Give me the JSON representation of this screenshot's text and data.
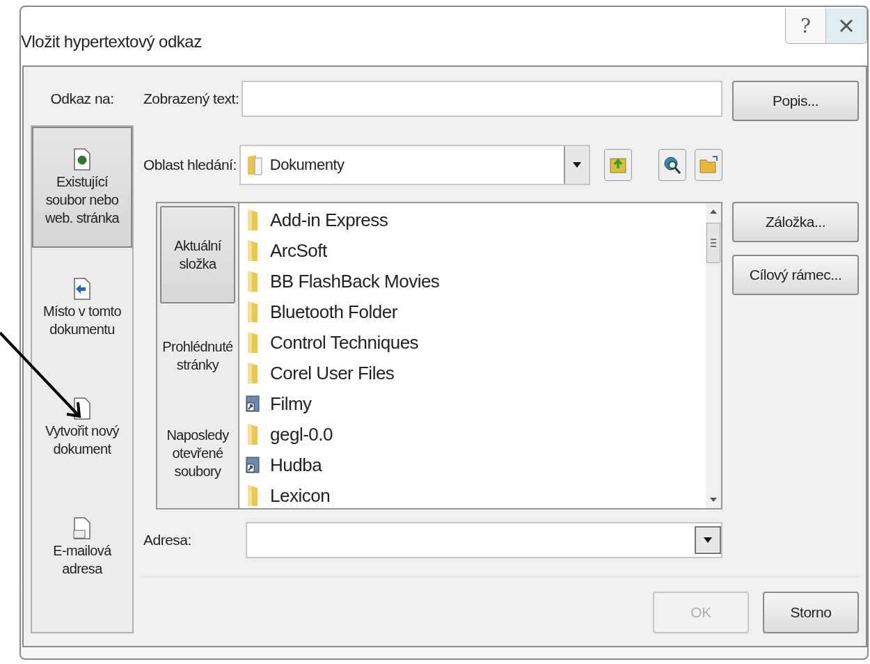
{
  "window": {
    "title": "Vložit hypertextový odkaz",
    "help": "?"
  },
  "link_to": {
    "label": "Odkaz na:",
    "items": [
      {
        "label": "Existující\nsoubor nebo\nweb. stránka",
        "kind": "file",
        "selected": true
      },
      {
        "label": "Místo v tomto\ndokumentu",
        "kind": "place",
        "selected": false
      },
      {
        "label": "Vytvořit nový\ndokument",
        "kind": "new",
        "selected": false
      },
      {
        "label": "E-mailová\nadresa",
        "kind": "mail",
        "selected": false
      }
    ]
  },
  "display_text": {
    "label": "Zobrazený text:"
  },
  "look_in": {
    "label": "Oblast hledání:",
    "value": "Dokumenty"
  },
  "places": [
    {
      "label": "Aktuální\nsložka",
      "selected": true
    },
    {
      "label": "Prohlédnuté\nstránky",
      "selected": false
    },
    {
      "label": "Naposledy\notevřené\nsoubory",
      "selected": false
    }
  ],
  "files": [
    {
      "name": "Add-in Express",
      "kind": "folder"
    },
    {
      "name": "ArcSoft",
      "kind": "folder"
    },
    {
      "name": "BB FlashBack Movies",
      "kind": "folder"
    },
    {
      "name": "Bluetooth Folder",
      "kind": "folder"
    },
    {
      "name": "Control Techniques",
      "kind": "folder"
    },
    {
      "name": "Corel User Files",
      "kind": "folder"
    },
    {
      "name": "Filmy",
      "kind": "shortcut"
    },
    {
      "name": "gegl-0.0",
      "kind": "folder"
    },
    {
      "name": "Hudba",
      "kind": "shortcut"
    },
    {
      "name": "Lexicon",
      "kind": "folder"
    }
  ],
  "address": {
    "label": "Adresa:"
  },
  "side_buttons": [
    {
      "label": "Popis...",
      "disabled": false
    },
    {
      "label": "Záložka...",
      "disabled": false
    },
    {
      "label": "Cílový rámec...",
      "disabled": false
    }
  ],
  "footer_buttons": [
    {
      "label": "OK",
      "disabled": true
    },
    {
      "label": "Storno",
      "disabled": false
    }
  ]
}
